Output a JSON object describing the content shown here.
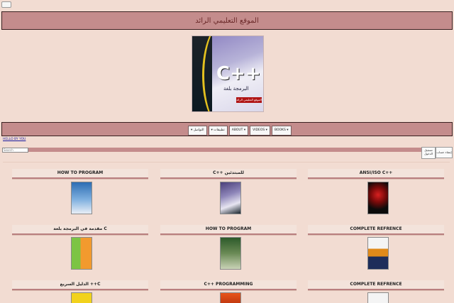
{
  "header": {
    "title": "الموقع التعليمي الرائد"
  },
  "hero": {
    "main_text": "C++",
    "sub_text": "البرمجة بلغة",
    "tag_text": "الموقع التعليمي الرائد"
  },
  "nav": {
    "items": [
      "▾ التواصل",
      "▾ تطبيقات",
      "ABOUT ▾",
      "VIDEOS ▾",
      "BOOKS ▾"
    ]
  },
  "user": {
    "greeting": "HELLO BY YOU"
  },
  "search": {
    "placeholder": "Search"
  },
  "auth": {
    "login_label_1": "تسجيل",
    "login_label_2": "الدخول",
    "register_label": "إنشاء حساب"
  },
  "cards": [
    {
      "title": "HOW TO PROGRAM"
    },
    {
      "title": "C++ للمبتدئين"
    },
    {
      "title": "ANSI/ISO C++"
    },
    {
      "title": "مقدمة في البرمجة بلغة C"
    },
    {
      "title": "HOW TO PROGRAM"
    },
    {
      "title": "COMPLETE REFRENCE"
    },
    {
      "title": "الدليل السريع ++C"
    },
    {
      "title": "C++ PROGRAMMING"
    },
    {
      "title": "COMPLETE REFRENCE"
    }
  ],
  "colors": {
    "accent": "#c48c8c",
    "background": "#f2dcd2",
    "border": "#3a2020"
  }
}
